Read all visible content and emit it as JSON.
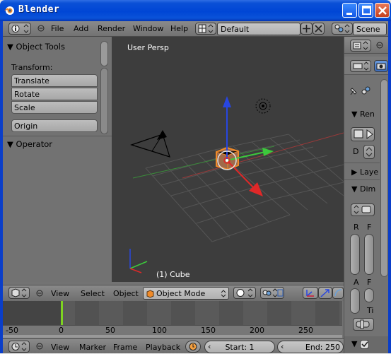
{
  "window": {
    "title": "Blender"
  },
  "menu": {
    "items": [
      "File",
      "Add",
      "Render",
      "Window",
      "Help"
    ],
    "screen_layout": "Default",
    "scene_label": "Scene"
  },
  "toolshelf": {
    "object_tools_header": "Object Tools",
    "transform_label": "Transform:",
    "translate": "Translate",
    "rotate": "Rotate",
    "scale": "Scale",
    "origin": "Origin",
    "operator_header": "Operator"
  },
  "viewport": {
    "view_label": "User Persp",
    "object_label": "(1) Cube"
  },
  "view3d_header": {
    "view": "View",
    "select": "Select",
    "object": "Object",
    "mode": "Object Mode"
  },
  "timeline": {
    "ticks": [
      "-50",
      "0",
      "50",
      "100",
      "150",
      "200",
      "250"
    ],
    "current_frame": 1
  },
  "timeline_header": {
    "view": "View",
    "marker": "Marker",
    "frame": "Frame",
    "playback": "Playback",
    "start": "Start: 1",
    "end": "End: 250"
  },
  "properties": {
    "render_header": "Ren",
    "layers_header": "Laye",
    "dimensions_header": "Dim",
    "d_label": "D",
    "r_label": "R",
    "f_label": "F",
    "a_label": "A",
    "f2_label": "F",
    "ti_label": "Ti"
  },
  "colors": {
    "titlebar": "#0a50d6",
    "viewport_bg": "#3d3d3d",
    "panel_bg": "#727272",
    "x_axis": "#e02828",
    "y_axis": "#3cc83c",
    "z_axis": "#2846e0",
    "selection": "#f08a28"
  }
}
